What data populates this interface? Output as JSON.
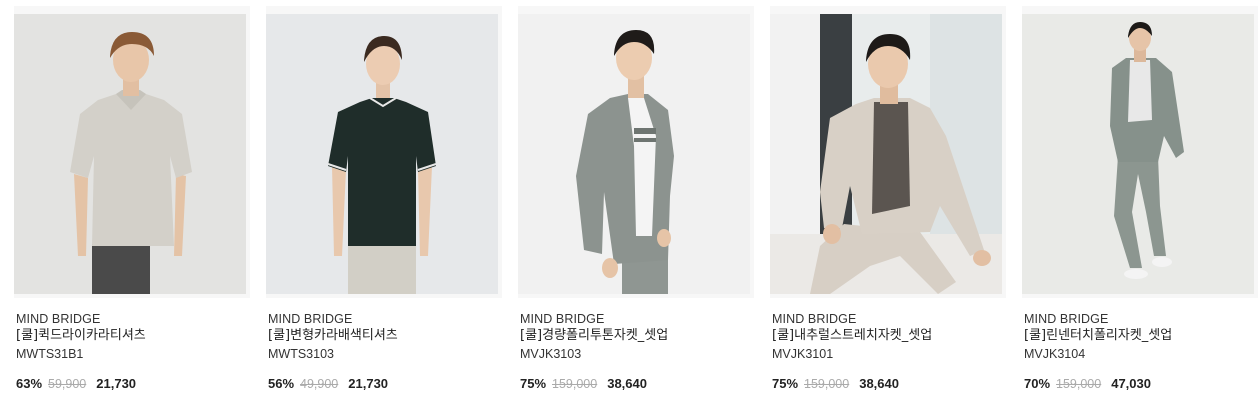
{
  "products": [
    {
      "brand": "MIND BRIDGE",
      "name": "[쿨]퀵드라이카라티셔츠",
      "code": "MWTS31B1",
      "discount": "63%",
      "original_price": "59,900",
      "sale_price": "21,730",
      "image": "model-beige-polo-shirt"
    },
    {
      "brand": "MIND BRIDGE",
      "name": "[쿨]변형카라배색티셔츠",
      "code": "MWTS3103",
      "discount": "56%",
      "original_price": "49,900",
      "sale_price": "21,730",
      "image": "model-dark-green-polo-shirt"
    },
    {
      "brand": "MIND BRIDGE",
      "name": "[쿨]경량폴리투톤자켓_셋업",
      "code": "MVJK3103",
      "discount": "75%",
      "original_price": "159,000",
      "sale_price": "38,640",
      "image": "model-grey-jacket-setup"
    },
    {
      "brand": "MIND BRIDGE",
      "name": "[쿨]내추럴스트레치자켓_셋업",
      "code": "MVJK3101",
      "discount": "75%",
      "original_price": "159,000",
      "sale_price": "38,640",
      "image": "model-beige-jacket-setup-seated"
    },
    {
      "brand": "MIND BRIDGE",
      "name": "[쿨]린넨터치폴리자켓_셋업",
      "code": "MVJK3104",
      "discount": "70%",
      "original_price": "159,000",
      "sale_price": "47,030",
      "image": "model-sage-jacket-setup-full"
    }
  ],
  "colors": {
    "discount": "#222222",
    "original_price": "#aaaaaa",
    "sale_price": "#222222",
    "image_bg": "#f7f7f7"
  }
}
